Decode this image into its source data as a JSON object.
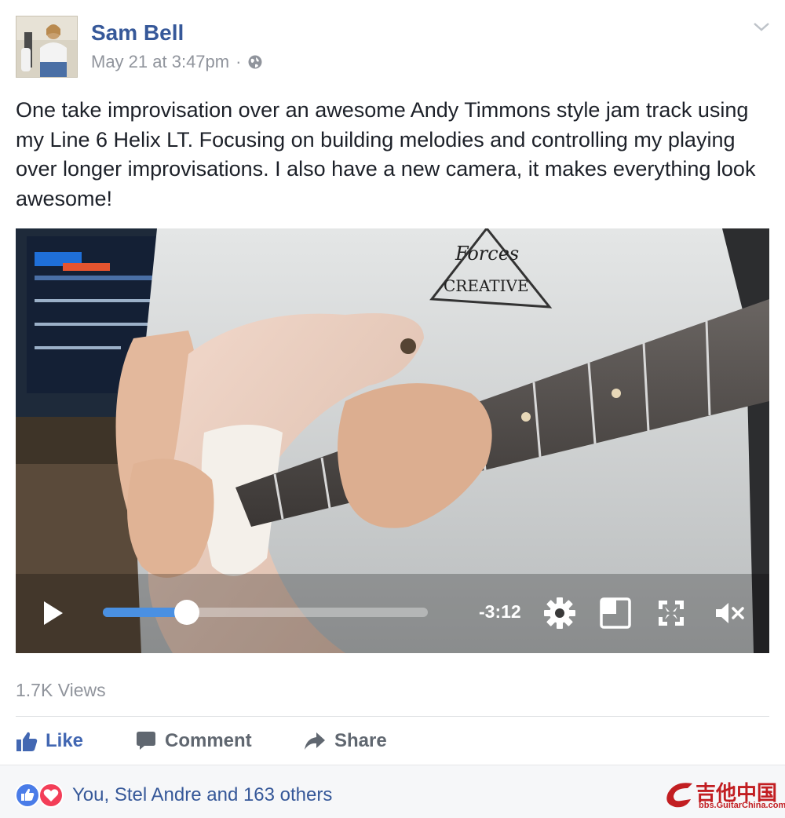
{
  "post": {
    "author": "Sam Bell",
    "timestamp": "May 21 at 3:47pm",
    "separator": "·",
    "privacy_icon": "globe-icon",
    "menu_icon": "chevron-down-icon",
    "text": "One take improvisation over an awesome Andy Timmons style jam track using my Line 6 Helix LT. Focusing on building melodies and controlling my playing over longer improvisations. I also have a new camera, it makes everything look awesome!"
  },
  "video": {
    "shirt_text_top": "Forces",
    "shirt_text_bottom": "CREATIVE",
    "time_remaining": "-3:12",
    "progress": 0.22,
    "controls": {
      "play_icon": "play-icon",
      "settings_icon": "gear-icon",
      "pip_icon": "picture-in-picture-icon",
      "fullscreen_icon": "fullscreen-icon",
      "mute_icon": "muted-speaker-icon"
    }
  },
  "stats": {
    "views": "1.7K Views"
  },
  "actions": {
    "like": "Like",
    "comment": "Comment",
    "share": "Share"
  },
  "reactions": {
    "text": "You, Stel Andre and 163 others",
    "icons": [
      "like-reaction-icon",
      "love-reaction-icon"
    ]
  },
  "watermark": {
    "title": "吉他中国",
    "url": "bbs.GuitarChina.com"
  },
  "colors": {
    "link_blue": "#365899",
    "like_blue": "#4267b2",
    "muted_gray": "#90949c",
    "progress_blue": "#4a90e2",
    "love_red": "#f33e58"
  }
}
